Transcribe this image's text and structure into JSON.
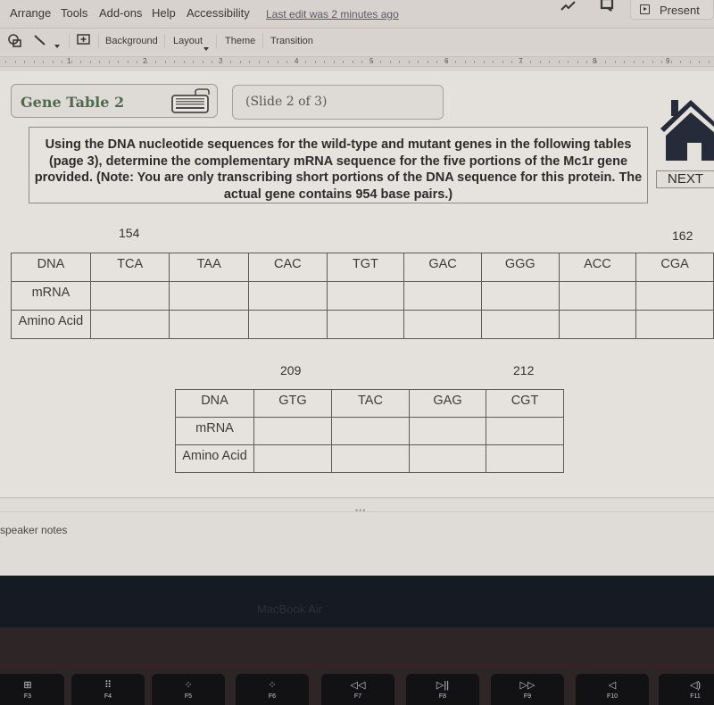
{
  "menubar": {
    "items": [
      "Arrange",
      "Tools",
      "Add-ons",
      "Help",
      "Accessibility"
    ],
    "last_edit": "Last edit was 2 minutes ago",
    "present_label": "Present"
  },
  "toolbar": {
    "background_label": "Background",
    "layout_label": "Layout",
    "theme_label": "Theme",
    "transition_label": "Transition"
  },
  "ruler": {
    "numbers": [
      "1",
      "2",
      "3",
      "4",
      "5",
      "6",
      "7",
      "8",
      "9"
    ]
  },
  "slide": {
    "title": "Gene Table 2",
    "slide_indicator": "(Slide 2 of 3)",
    "instructions": "Using the DNA nucleotide sequences for the wild-type and mutant genes in the following tables (page 3), determine the complementary mRNA sequence for the five portions of the Mc1r gene provided. (Note: You are only transcribing short portions of the DNA sequence for this protein. The actual gene contains 954 base pairs.)",
    "next_label": "NEXT",
    "table1": {
      "start_position": "154",
      "end_position": "162",
      "row_labels": [
        "DNA",
        "mRNA",
        "Amino Acid"
      ],
      "dna": [
        "TCA",
        "TAA",
        "CAC",
        "TGT",
        "GAC",
        "GGG",
        "ACC",
        "CGA"
      ],
      "mrna": [
        "",
        "",
        "",
        "",
        "",
        "",
        "",
        ""
      ],
      "amino_acid": [
        "",
        "",
        "",
        "",
        "",
        "",
        "",
        ""
      ]
    },
    "table2": {
      "start_position": "209",
      "end_position": "212",
      "row_labels": [
        "DNA",
        "mRNA",
        "Amino Acid"
      ],
      "dna": [
        "GTG",
        "TAC",
        "GAG",
        "CGT"
      ],
      "mrna": [
        "",
        "",
        "",
        ""
      ],
      "amino_acid": [
        "",
        "",
        "",
        ""
      ]
    }
  },
  "notes": {
    "placeholder": "speaker notes",
    "resize_handle": "•••"
  },
  "device": {
    "brand": "MacBook Air",
    "fkeys": [
      {
        "name": "F3",
        "glyph": "⊞"
      },
      {
        "name": "F4",
        "glyph": "⠿"
      },
      {
        "name": "F5",
        "glyph": "⁘"
      },
      {
        "name": "F6",
        "glyph": "⁘"
      },
      {
        "name": "F7",
        "glyph": "◁◁"
      },
      {
        "name": "F8",
        "glyph": "▷||"
      },
      {
        "name": "F9",
        "glyph": "▷▷"
      },
      {
        "name": "F10",
        "glyph": "◁"
      },
      {
        "name": "F11",
        "glyph": "◁)"
      }
    ]
  }
}
